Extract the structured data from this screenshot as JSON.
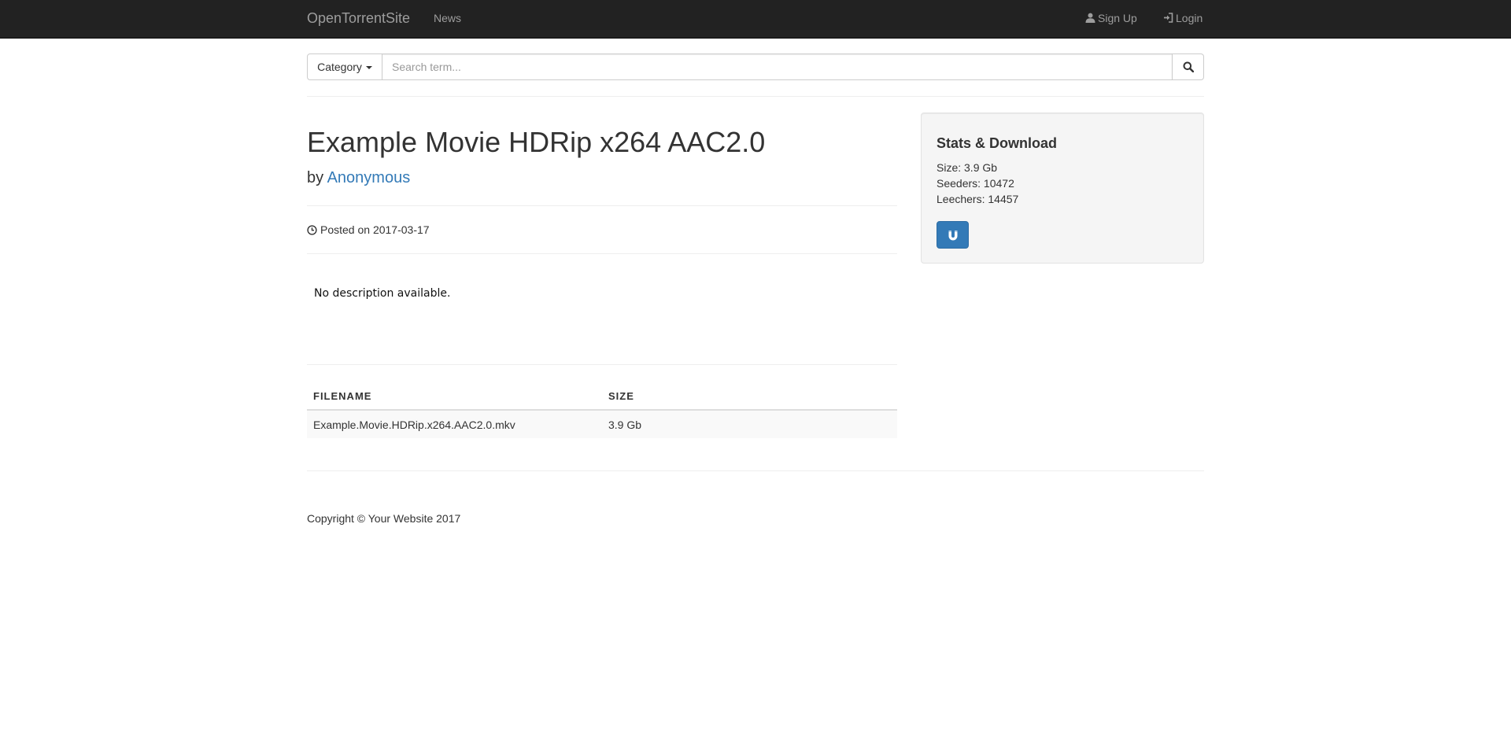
{
  "navbar": {
    "brand": "OpenTorrentSite",
    "news": "News",
    "signup": "Sign Up",
    "login": "Login"
  },
  "search": {
    "category_label": "Category",
    "placeholder": "Search term..."
  },
  "torrent": {
    "title": "Example Movie HDRip x264 AAC2.0",
    "by_prefix": "by",
    "author": "Anonymous",
    "posted": "Posted on 2017-03-17",
    "description": "No description available."
  },
  "files_table": {
    "headers": [
      "FILENAME",
      "SIZE"
    ],
    "rows": [
      [
        "Example.Movie.HDRip.x264.AAC2.0.mkv",
        "3.9 Gb"
      ]
    ]
  },
  "stats": {
    "title": "Stats & Download",
    "size": "Size: 3.9 Gb",
    "seeders": "Seeders: 10472",
    "leechers": "Leechers: 14457",
    "download_icon": "magnet-icon"
  },
  "footer": {
    "copyright": "Copyright © Your Website 2017"
  },
  "colors": {
    "navbar_bg": "#222222",
    "link": "#337ab7",
    "button_primary": "#337ab7",
    "well_bg": "#f5f5f5"
  }
}
